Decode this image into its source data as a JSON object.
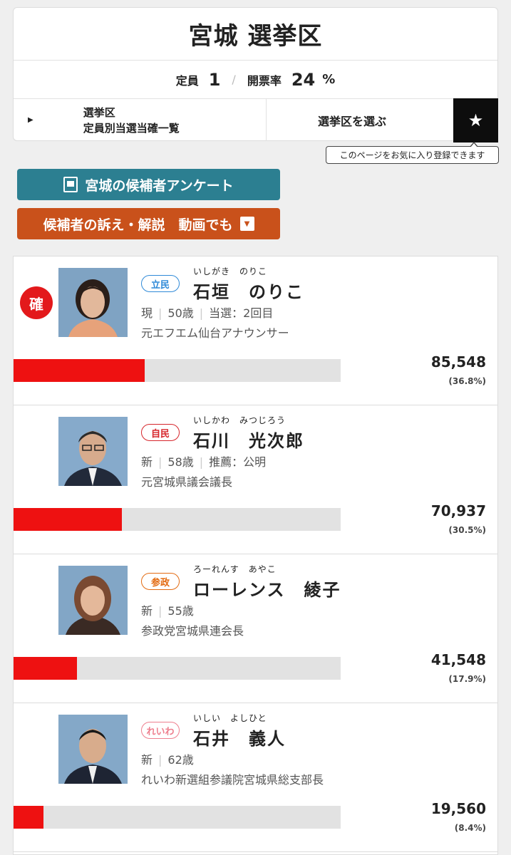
{
  "header": {
    "title": "宮城 選挙区",
    "seats_label": "定員",
    "seats_value": "1",
    "turnout_label": "開票率",
    "turnout_value": "24",
    "turnout_unit": "%",
    "nav_link_line1": "選挙区",
    "nav_link_line2": "定員別当選当確一覧",
    "select_label": "選挙区を選ぶ",
    "favorite_tooltip": "このページをお気に入り登録できます"
  },
  "actions": {
    "survey_label": "宮城の候補者アンケート",
    "video_label": "候補者の訴え・解説　動画でも"
  },
  "candidates": [
    {
      "elected_mark": "確",
      "party": "立民",
      "party_color": "#2f8ad8",
      "ruby": "いしがき　のりこ",
      "name": "石垣　のりこ",
      "status": "現",
      "age": "50歳",
      "extra": "当選：2回目",
      "career": "元エフエム仙台アナウンサー",
      "votes": "85,548",
      "percent_label": "(36.8%)",
      "share": 0.368
    },
    {
      "elected_mark": "",
      "party": "自民",
      "party_color": "#d6252b",
      "ruby": "いしかわ　みつじろう",
      "name": "石川　光次郎",
      "status": "新",
      "age": "58歳",
      "extra": "推薦：公明",
      "career": "元宮城県議会議長",
      "votes": "70,937",
      "percent_label": "(30.5%)",
      "share": 0.305
    },
    {
      "elected_mark": "",
      "party": "参政",
      "party_color": "#e36b12",
      "ruby": "ろーれんす　あやこ",
      "name": "ローレンス　綾子",
      "status": "新",
      "age": "55歳",
      "extra": "",
      "career": "参政党宮城県連会長",
      "votes": "41,548",
      "percent_label": "(17.9%)",
      "share": 0.179
    },
    {
      "elected_mark": "",
      "party": "れいわ",
      "party_color": "#ee7f8e",
      "ruby": "いしい　よしひと",
      "name": "石井　義人",
      "status": "新",
      "age": "62歳",
      "extra": "",
      "career": "れいわ新選組参議院宮城県総支部長",
      "votes": "19,560",
      "percent_label": "(8.4%)",
      "share": 0.084
    }
  ]
}
